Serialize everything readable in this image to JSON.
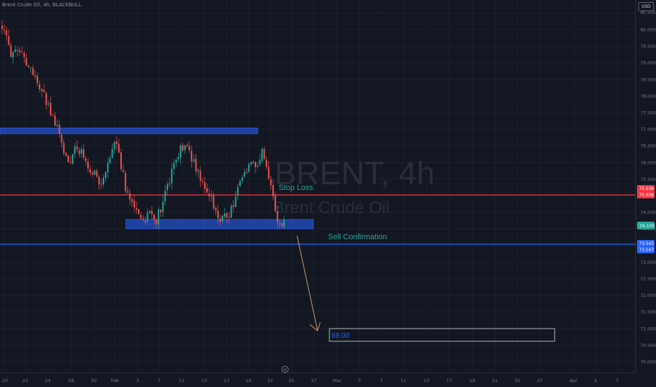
{
  "header": {
    "symbol_label": "Brent Crude Oil, 4h, BLACKBULL",
    "currency": "USD"
  },
  "colors": {
    "background": "#131722",
    "grid": "#1e222d",
    "up": "#26a69a",
    "down": "#ef5350",
    "zone": "#2962ff",
    "stop_loss": "#f23645",
    "confirmation": "#2962ff",
    "arrow": "#d19a66",
    "annotation_text": "#26a69a",
    "target_text": "#2962ff"
  },
  "chart_data": {
    "type": "candlestick",
    "watermark": {
      "title": "BRENT, 4h",
      "subtitle": "Brent Crude Oil"
    },
    "y_axis": {
      "range": [
        69.8,
        80.4
      ],
      "ticks": [
        "80.000",
        "79.500",
        "79.000",
        "78.500",
        "78.000",
        "77.500",
        "77.000",
        "76.500",
        "76.000",
        "75.500",
        "74.500",
        "74.000",
        "73.000",
        "72.500",
        "72.000",
        "71.500",
        "71.000",
        "70.500",
        "70.000"
      ],
      "top_tick_partial": "80.500"
    },
    "x_axis": {
      "ticks": [
        "20",
        "22",
        "24",
        "28",
        "30",
        "Feb",
        "5",
        "7",
        "11",
        "13",
        "17",
        "19",
        "21",
        "25",
        "27",
        "Mar",
        "5",
        "7",
        "11",
        "13",
        "17",
        "19",
        "21",
        "25",
        "27",
        "Apr",
        "3",
        "7"
      ]
    },
    "zones": [
      {
        "name": "resistance",
        "from": 76.88,
        "to": 77.05
      },
      {
        "name": "support",
        "from": 74.08,
        "to": 74.35
      }
    ],
    "levels": [
      {
        "name": "Stop Loss",
        "price": 75.03,
        "axis_labels": [
          "75.036",
          "75.036"
        ]
      },
      {
        "name": "Sell Confirmation",
        "price": 73.56,
        "axis_labels": [
          "73.543",
          "73.547"
        ]
      }
    ],
    "last_price": {
      "value": 74.105,
      "label": "74.105"
    },
    "target": {
      "label": "69.00",
      "price": 70.8
    },
    "annotations": [
      "Stop Loss",
      "Sell Confirmation"
    ],
    "candle_path": [
      [
        0,
        80.1
      ],
      [
        4,
        79.3
      ],
      [
        9,
        79.2
      ],
      [
        14,
        78.7
      ],
      [
        19,
        78.0
      ],
      [
        22,
        77.55
      ],
      [
        27,
        76.6
      ],
      [
        30,
        75.95
      ],
      [
        33,
        76.45
      ],
      [
        37,
        76.2
      ],
      [
        41,
        75.7
      ],
      [
        45,
        75.3
      ],
      [
        49,
        76.05
      ],
      [
        52,
        76.7
      ],
      [
        56,
        75.2
      ],
      [
        60,
        74.65
      ],
      [
        64,
        74.25
      ],
      [
        67,
        74.5
      ],
      [
        70,
        74.25
      ],
      [
        73,
        74.85
      ],
      [
        77,
        75.65
      ],
      [
        81,
        76.35
      ],
      [
        84,
        76.55
      ],
      [
        88,
        75.8
      ],
      [
        92,
        75.25
      ],
      [
        96,
        74.75
      ],
      [
        99,
        74.3
      ],
      [
        103,
        74.45
      ],
      [
        106,
        74.95
      ],
      [
        109,
        75.55
      ],
      [
        113,
        76.1
      ],
      [
        116,
        75.85
      ],
      [
        118,
        76.25
      ],
      [
        122,
        75.45
      ],
      [
        124,
        74.45
      ],
      [
        126,
        74.05
      ],
      [
        128,
        74.25
      ]
    ],
    "candles_shown": 129
  }
}
